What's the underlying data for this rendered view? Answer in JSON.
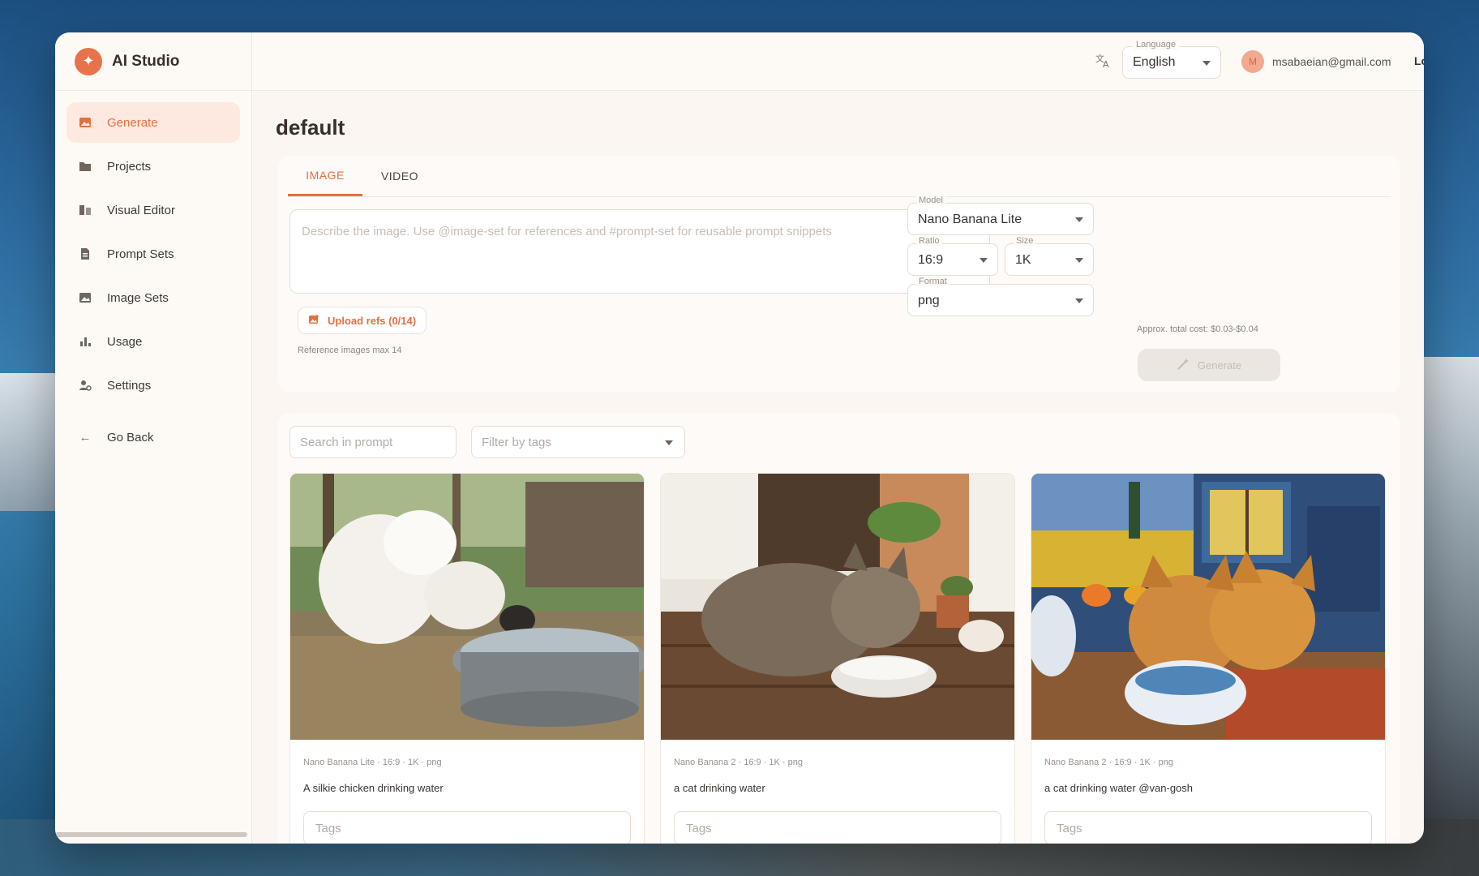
{
  "app": {
    "name": "AI Studio"
  },
  "sidebar": {
    "items": [
      {
        "label": "Generate",
        "icon": "image-icon",
        "active": true
      },
      {
        "label": "Projects",
        "icon": "folder-icon"
      },
      {
        "label": "Visual Editor",
        "icon": "visual-editor-icon"
      },
      {
        "label": "Prompt Sets",
        "icon": "document-icon"
      },
      {
        "label": "Image Sets",
        "icon": "image-set-icon"
      },
      {
        "label": "Usage",
        "icon": "bar-chart-icon"
      },
      {
        "label": "Settings",
        "icon": "settings-icon"
      }
    ],
    "back_label": "Go Back"
  },
  "topbar": {
    "language_label": "Language",
    "language_value": "English",
    "avatar_initial": "M",
    "user_email": "msabaeian@gmail.com",
    "logout_label": "Logout"
  },
  "page": {
    "title": "default"
  },
  "generator": {
    "tabs": [
      "IMAGE",
      "VIDEO"
    ],
    "active_tab": "IMAGE",
    "prompt_placeholder": "Describe the image. Use @image-set for references and #prompt-set for reusable prompt snippets",
    "upload_label": "Upload refs (0/14)",
    "ref_hint": "Reference images max 14",
    "model": {
      "label": "Model",
      "value": "Nano Banana Lite"
    },
    "ratio": {
      "label": "Ratio",
      "value": "16:9"
    },
    "size": {
      "label": "Size",
      "value": "1K"
    },
    "format": {
      "label": "Format",
      "value": "png"
    },
    "cost_text": "Approx. total cost: $0.03-$0.04",
    "generate_label": "Generate"
  },
  "gallery": {
    "search_placeholder": "Search in prompt",
    "filter_placeholder": "Filter by tags",
    "cards": [
      {
        "meta": "Nano Banana Lite · 16:9 · 1K · png",
        "caption": "A silkie chicken drinking water",
        "tags_placeholder": "Tags"
      },
      {
        "meta": "Nano Banana 2 · 16:9 · 1K · png",
        "caption": "a cat drinking water",
        "tags_placeholder": "Tags"
      },
      {
        "meta": "Nano Banana 2 · 16:9 · 1K · png",
        "caption": "a cat drinking water @van-gosh",
        "tags_placeholder": "Tags"
      }
    ]
  },
  "colors": {
    "accent": "#e4703f",
    "active_bg": "#fde9df",
    "window_bg": "#fbf6f1"
  }
}
